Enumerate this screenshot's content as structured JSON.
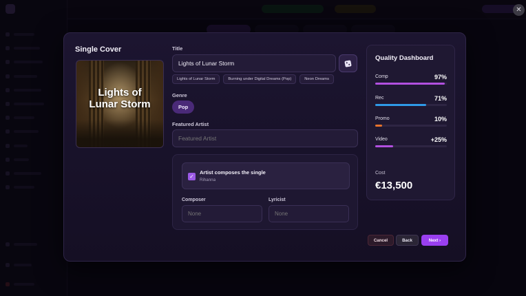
{
  "dialog": {
    "left_title": "Single Cover",
    "cover_text": "Lights of Lunar Storm",
    "title_label": "Title",
    "title_value": "Lights of Lunar Storm",
    "title_suggestions": [
      "Lights of Lunar Storm",
      "Burning under Digital Dreams (Pop)",
      "Neon Dreams"
    ],
    "genre_label": "Genre",
    "genre_value": "Pop",
    "featured_label": "Featured Artist",
    "featured_placeholder": "Featured Artist",
    "composes": {
      "title": "Artist composes the single",
      "artist": "Rihanna",
      "checked": true
    },
    "composer_label": "Composer",
    "composer_placeholder": "None",
    "lyricist_label": "Lyricist",
    "lyricist_placeholder": "None",
    "buttons": {
      "cancel": "Cancel",
      "back": "Back",
      "next": "Next ›"
    }
  },
  "dashboard": {
    "title": "Quality Dashboard",
    "metrics": [
      {
        "name": "Comp",
        "value": "97%",
        "level": 0.97,
        "color": "#b250e0"
      },
      {
        "name": "Rec",
        "value": "71%",
        "level": 0.71,
        "color": "#2f9ae8"
      },
      {
        "name": "Promo",
        "value": "10%",
        "level": 0.1,
        "color": "#e8732c"
      },
      {
        "name": "Video",
        "value": "+25%",
        "level": 0.25,
        "color": "#b250e0"
      }
    ],
    "cost_label": "Cost",
    "cost_value": "€13,500"
  },
  "icons": {
    "close": "close-icon",
    "randomize": "dice-icon",
    "check": "check-icon"
  },
  "colors": {
    "accent": "#9a3ff0",
    "modal_bg": "#1a1429",
    "page_bg": "#0b0714"
  }
}
